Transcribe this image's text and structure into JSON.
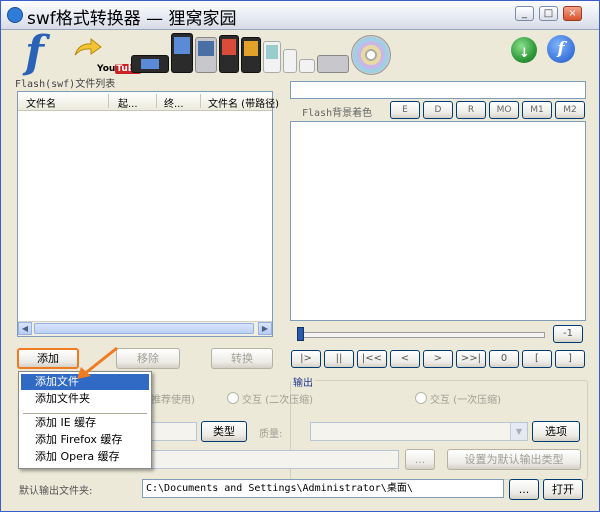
{
  "window": {
    "title": "swf格式转换器 — 狸窝家园",
    "minimize": "_",
    "maximize": "□",
    "close": "×"
  },
  "banner": {
    "flash_logo": "f",
    "youtube_you": "You",
    "youtube_tube": "Tube"
  },
  "file_list": {
    "label": "Flash(swf)文件列表",
    "columns": [
      "文件名",
      "起...",
      "终...",
      "文件名 (带路径)"
    ]
  },
  "list_buttons": {
    "add": "添加",
    "remove": "移除",
    "convert": "转换"
  },
  "preview": {
    "bg_color_label": "Flash背景着色",
    "color_buttons": [
      "E",
      "D",
      "R",
      "MO",
      "M1",
      "M2"
    ],
    "time_value": "-1",
    "player_buttons": [
      "|>",
      "||",
      "|<<",
      "<",
      ">",
      ">>|",
      "0",
      "[",
      "]"
    ]
  },
  "output": {
    "legend": "输出",
    "radios": [
      "推荐使用)",
      "交互 (二次压缩)",
      "交互 (一次压缩)"
    ],
    "type_button": "类型",
    "quality_label": "质量:",
    "options_button": "选项",
    "browse_button": "...",
    "set_default_button": "设置为默认输出类型"
  },
  "footer": {
    "default_folder_label": "默认输出文件夹:",
    "default_folder_path": "C:\\Documents and Settings\\Administrator\\桌面\\",
    "browse_button": "...",
    "open_button": "打开"
  },
  "context_menu": {
    "items": [
      "添加文件",
      "添加文件夹",
      "添加 IE 缓存",
      "添加 Firefox 缓存",
      "添加 Opera 缓存"
    ],
    "selected_index": 0
  },
  "colors": {
    "selection": "#316ac5",
    "highlight_border": "#f07c22",
    "window_bg": "#ece9d8"
  }
}
